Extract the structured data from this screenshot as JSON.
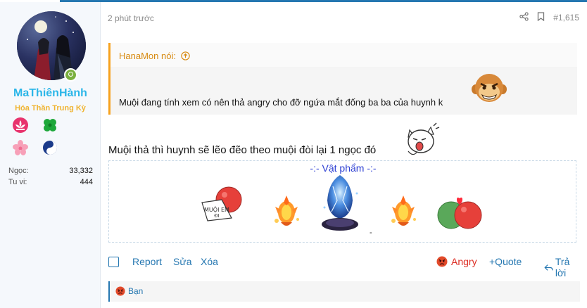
{
  "user": {
    "name": "MaThiênHành",
    "title": "Hóa Thần Trung Kỳ",
    "stats": [
      {
        "label": "Ngọc:",
        "value": "33,332"
      },
      {
        "label": "Tu vi:",
        "value": "444"
      }
    ],
    "badges": [
      "lotus-badge",
      "clover-badge",
      "sakura-badge",
      "yinyang-badge"
    ]
  },
  "post": {
    "time": "2 phút trước",
    "number": "#1,615",
    "quote_author": "HanaMon nói:",
    "quote_text": "Muội đang tính xem có nên thả angry cho đỡ ngứa mắt đống ba ba của huynh k",
    "message": "Muội thả thì huynh sẽ lẽo đẽo theo muội đòi lại 1 ngọc đó",
    "item_title": "-:- Vật phẩm -:-",
    "item_box_text": "MUỘI EM ĐI",
    "item_dash": "-"
  },
  "actions": {
    "report": "Report",
    "edit": "Sửa",
    "delete": "Xóa",
    "angry": "Angry",
    "quote": "+Quote",
    "reply": "Trả lời"
  },
  "reactions": {
    "label": "Bạn"
  },
  "colors": {
    "accent": "#2577b1",
    "username": "#2bb6e8",
    "title": "#f0b432",
    "quote_border": "#f7a21f",
    "angry": "#dd2d23"
  }
}
